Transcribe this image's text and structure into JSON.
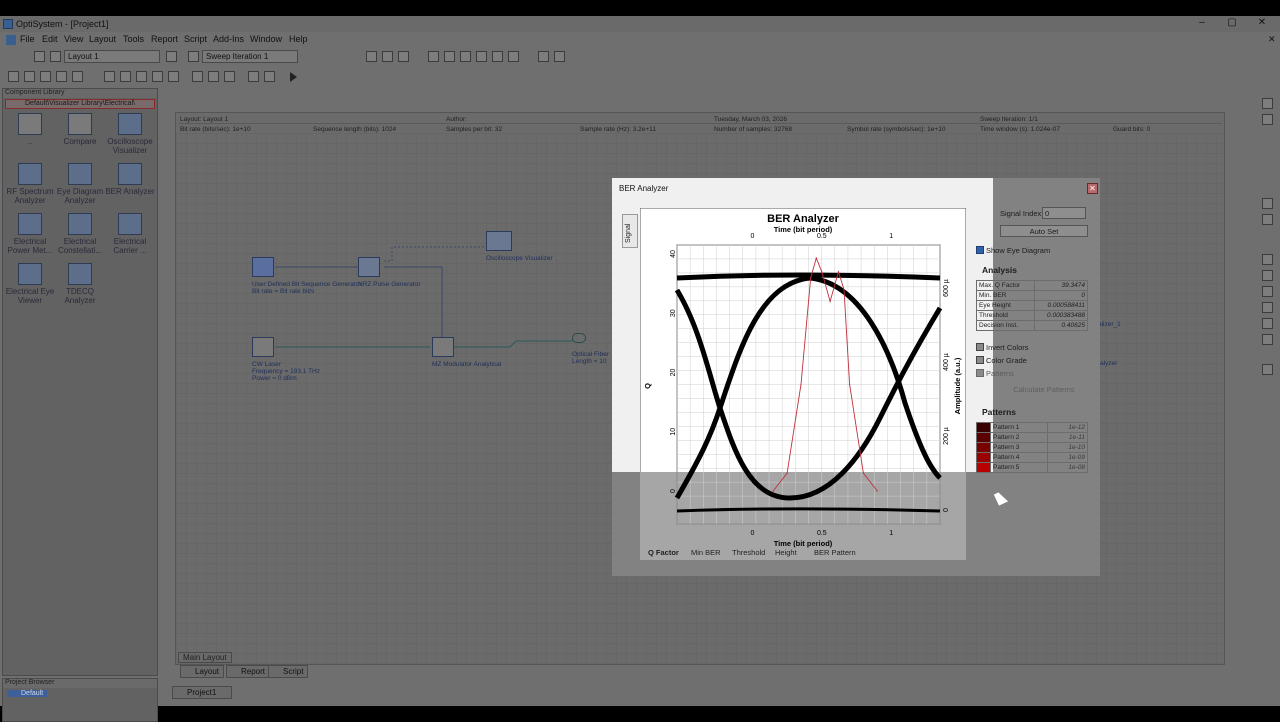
{
  "window": {
    "title": "OptiSystem - [Project1]"
  },
  "menu": [
    "File",
    "Edit",
    "View",
    "Layout",
    "Tools",
    "Report",
    "Script",
    "Add-Ins",
    "Window",
    "Help"
  ],
  "toolbar": {
    "layout_select": "Layout 1",
    "sweep_select": "Sweep Iteration 1"
  },
  "component_library": {
    "header": "Component Library",
    "path": "Default\\Visualizer Library\\Electrical\\",
    "items": [
      {
        "label": "..",
        "icon": "folder-up-icon"
      },
      {
        "label": "Compare",
        "icon": "folder-icon"
      },
      {
        "label": "Oscilloscope Visualizer",
        "icon": "oscilloscope-icon"
      },
      {
        "label": "RF Spectrum Analyzer",
        "icon": "spectrum-icon"
      },
      {
        "label": "Eye Diagram Analyzer",
        "icon": "eye-diagram-icon"
      },
      {
        "label": "BER Analyzer",
        "icon": "ber-icon"
      },
      {
        "label": "Electrical Power Met...",
        "icon": "power-meter-icon"
      },
      {
        "label": "Electrical Constellati...",
        "icon": "constellation-icon"
      },
      {
        "label": "Electrical Carrier ...",
        "icon": "carrier-icon"
      },
      {
        "label": "Electrical Eye Viewer",
        "icon": "eye-viewer-icon"
      },
      {
        "label": "TDECQ Analyzer",
        "icon": "tdecq-icon"
      }
    ]
  },
  "project_browser": {
    "header": "Project Browser",
    "item": "Default"
  },
  "layout_info": {
    "row1": [
      "Layout: Layout 1",
      "Author:",
      "Tuesday, March 03, 2026",
      "Sweep Iteration: 1/1"
    ],
    "row2": [
      "Bit rate (bits/sec): 1e+10",
      "Sequence length (bits): 1024",
      "Samples per bit: 32",
      "Sample rate (Hz): 3.2e+11",
      "Number of samples: 32768",
      "Symbol rate (symbols/sec): 1e+10",
      "Time window (s): 1.024e-07",
      "Guard bits: 0"
    ]
  },
  "components": {
    "prbs": [
      "User Defined Bit Sequence Generator",
      "Bit rate = Bit rate  bit/s"
    ],
    "nrz": "NRZ Pulse Generator",
    "scope": "Oscilloscope Visualizer",
    "laser": [
      "CW Laser",
      "Frequency = 193.1  THz",
      "Power = 0  dBm"
    ],
    "mz": "MZ Modulator Analytical",
    "fiber": [
      "Optical Fiber",
      "Length = 10"
    ],
    "right1": "alizer_1",
    "right2": "alyzer"
  },
  "canvas_tabs": [
    "Main Layout"
  ],
  "view_tabs": [
    "Layout",
    "Report",
    "Script"
  ],
  "doc_tab": "Project1",
  "dialog": {
    "caption": "BER Analyzer",
    "side_tab": "Signal",
    "signal_index_label": "Signal Index:",
    "signal_index_value": "0",
    "auto_set": "Auto Set",
    "show_eye_diagram": "Show Eye Diagram",
    "analysis_title": "Analysis",
    "analysis": [
      [
        "Max. Q Factor",
        "39.3474"
      ],
      [
        "Min. BER",
        "0"
      ],
      [
        "Eye Height",
        "0.000588411"
      ],
      [
        "Threshold",
        "0.000383488"
      ],
      [
        "Decision Inst.",
        "0.40625"
      ]
    ],
    "invert_colors": "Invert Colors",
    "color_grade": "Color Grade",
    "patterns_cb": "Patterns",
    "calc_patterns": "Calculate Patterns",
    "patterns_title": "Patterns",
    "patterns": [
      [
        "Pattern 1",
        "1e-12"
      ],
      [
        "Pattern 2",
        "1e-11"
      ],
      [
        "Pattern 3",
        "1e-10"
      ],
      [
        "Pattern 4",
        "1e-09"
      ],
      [
        "Pattern 5",
        "1e-08"
      ]
    ],
    "pattern_colors": [
      "#3a0000",
      "#5a0000",
      "#7a0000",
      "#9a0000",
      "#b80000"
    ],
    "plot_tabs": [
      "Q Factor",
      "Min BER",
      "Threshold",
      "Height",
      "BER Pattern"
    ]
  },
  "chart_data": {
    "type": "line",
    "title": "BER Analyzer",
    "xlabel": "Time (bit period)",
    "ylabel_left": "Q",
    "ylabel_right": "Amplitude (a.u.)",
    "xlim": [
      -0.5,
      1.3
    ],
    "x_ticks": [
      "0",
      "0.5",
      "1"
    ],
    "q_ticks": [
      "0",
      "10",
      "20",
      "30",
      "40"
    ],
    "amp_ticks": [
      "0",
      "200 µ",
      "400 µ",
      "600 µ"
    ],
    "series": [
      {
        "x": [
          0.15,
          0.25,
          0.35,
          0.42,
          0.46,
          0.5,
          0.56,
          0.62,
          0.66,
          0.7,
          0.8,
          0.9
        ],
        "values": [
          0,
          3,
          18,
          36,
          39.3,
          37,
          32,
          37,
          34,
          18,
          3,
          0
        ]
      }
    ]
  }
}
